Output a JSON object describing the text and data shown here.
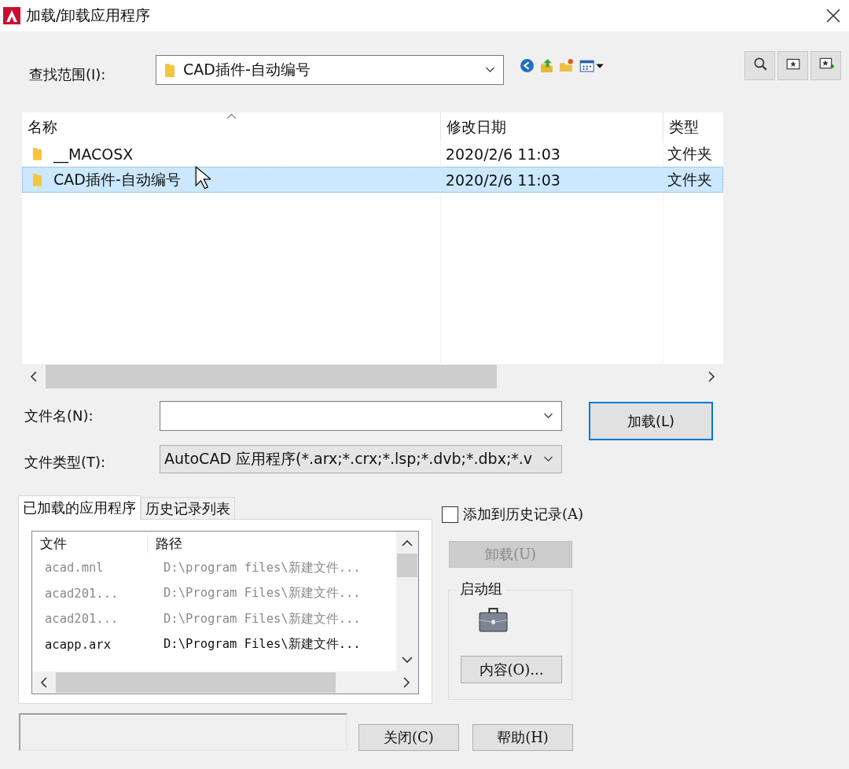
{
  "window": {
    "title": "加载/卸载应用程序"
  },
  "look_in": {
    "label": "查找范围(I):",
    "value": "CAD插件-自动编号"
  },
  "file_list": {
    "columns": [
      "名称",
      "修改日期",
      "类型"
    ],
    "rows": [
      {
        "name": "__MACOSX",
        "date": "2020/2/6 11:03",
        "type": "文件夹",
        "selected": false
      },
      {
        "name": "CAD插件-自动编号",
        "date": "2020/2/6 11:03",
        "type": "文件夹",
        "selected": true
      }
    ]
  },
  "file_name": {
    "label": "文件名(N):"
  },
  "file_type": {
    "label": "文件类型(T):",
    "value": "AutoCAD 应用程序(*.arx;*.crx;*.lsp;*.dvb;*.dbx;*.v"
  },
  "load_button": {
    "label": "加载(L)",
    "default": true
  },
  "tabs": [
    {
      "label": "已加载的应用程序",
      "selected": true
    },
    {
      "label": "历史记录列表",
      "selected": false
    }
  ],
  "loaded_apps": {
    "columns": [
      "文件",
      "路径"
    ],
    "rows": [
      {
        "file": "acad.mnl",
        "path": "D:\\program files\\新建文件...",
        "dimmed": true
      },
      {
        "file": "acad201...",
        "path": "D:\\Program Files\\新建文件...",
        "dimmed": true
      },
      {
        "file": "acad201...",
        "path": "D:\\Program Files\\新建文件...",
        "dimmed": true
      },
      {
        "file": "acapp.arx",
        "path": "D:\\Program Files\\新建文件...",
        "dimmed": false
      }
    ]
  },
  "add_to_history": {
    "label": "添加到历史记录(A)",
    "checked": false
  },
  "unload_button": {
    "label": "卸载(U)",
    "disabled": true
  },
  "startup_group": {
    "title": "启动组",
    "button": "内容(O)..."
  },
  "buttons": [
    {
      "label": "关闭(C)"
    },
    {
      "label": "帮助(H)"
    }
  ]
}
